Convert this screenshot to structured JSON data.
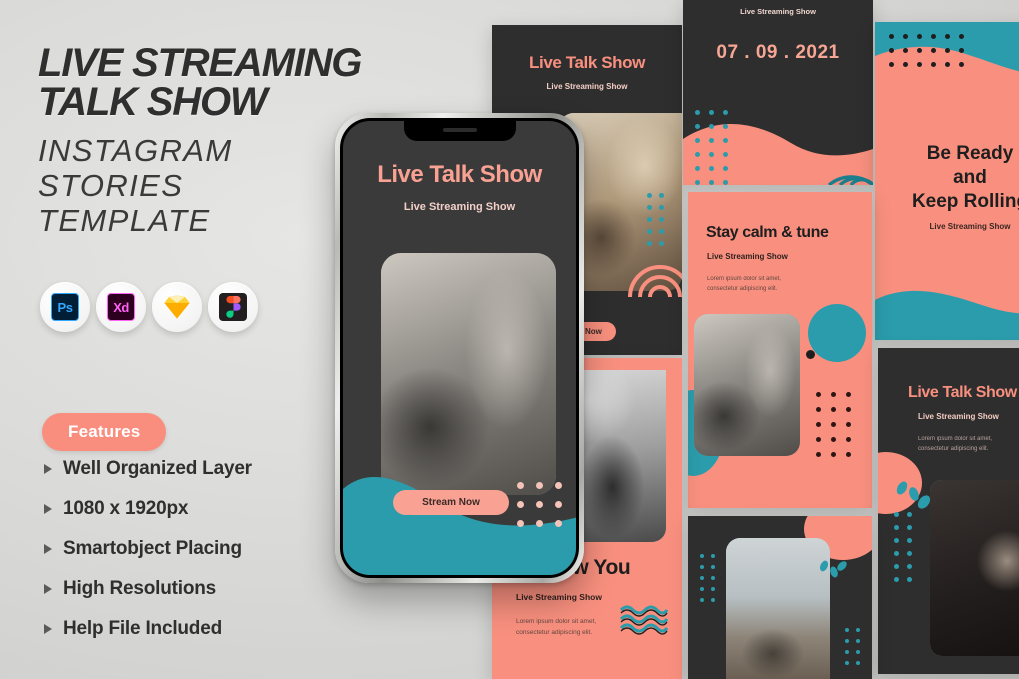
{
  "left_panel": {
    "title_line1": "LIVE STREAMING",
    "title_line2": "TALK SHOW",
    "subtitle_line1": "INSTAGRAM",
    "subtitle_line2": "STORIES",
    "subtitle_line3": "TEMPLATE",
    "apps": [
      {
        "name": "photoshop",
        "label": "Ps"
      },
      {
        "name": "adobe-xd",
        "label": "Xd"
      },
      {
        "name": "sketch",
        "label": ""
      },
      {
        "name": "figma",
        "label": ""
      }
    ],
    "features_badge": "Features",
    "features": [
      "Well Organized Layer",
      "1080 x 1920px",
      "Smartobject Placing",
      "High Resolutions",
      "Help File Included"
    ]
  },
  "phone_mockup": {
    "title": "Live Talk Show",
    "subtitle": "Live Streaming Show",
    "button": "Stream Now"
  },
  "cards": {
    "top_dark": {
      "title": "Live Talk Show",
      "subtitle": "Live Streaming Show",
      "button": "Learn Now"
    },
    "date_card": {
      "subtitle": "Live Streaming Show",
      "date": "07 . 09 . 2021"
    },
    "be_ready": {
      "title_line1": "Be Ready",
      "title_line2": "and",
      "title_line3": "Keep Rolling",
      "subtitle": "Live Streaming Show"
    },
    "stay_calm": {
      "title": "Stay calm & tune",
      "subtitle": "Live Streaming Show",
      "lorem_line1": "Lorem ipsum dolor sit amet,",
      "lorem_line2": "consectetur adipiscing elit."
    },
    "right_dark": {
      "title": "Live Talk Show",
      "subtitle": "Live Streaming Show",
      "lorem_line1": "Lorem ipsum dolor sit amet,",
      "lorem_line2": "consectetur adipiscing elit."
    },
    "show_you": {
      "title": "ow You",
      "subtitle": "Live Streaming Show",
      "lorem_line1": "Lorem ipsum dolor sit amet,",
      "lorem_line2": "consectetur adipiscing elit."
    }
  },
  "colors": {
    "coral": "#f9907f",
    "teal": "#2b9cab",
    "dark": "#2e2e2e",
    "background": "#dcdcda"
  }
}
